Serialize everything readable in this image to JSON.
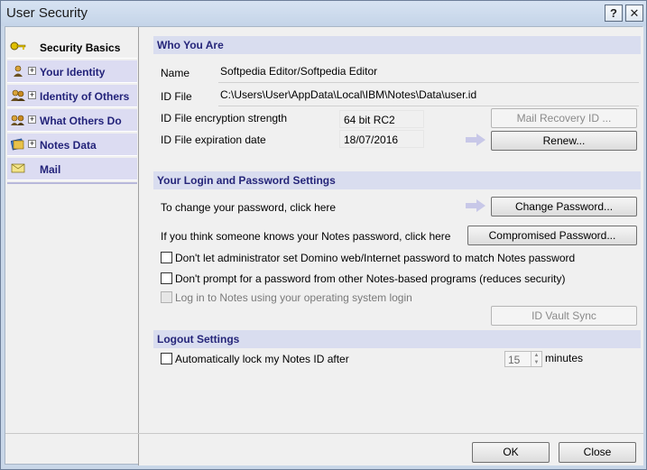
{
  "window": {
    "title": "User Security",
    "help_glyph": "?",
    "close_glyph": "✕"
  },
  "sidebar": {
    "items": [
      {
        "label": "Security Basics",
        "icon": "key-icon",
        "expandable": false,
        "active": true
      },
      {
        "label": "Your Identity",
        "icon": "person-icon",
        "expandable": true,
        "active": false
      },
      {
        "label": "Identity of Others",
        "icon": "people-icon",
        "expandable": true,
        "active": false
      },
      {
        "label": "What Others Do",
        "icon": "keys-icon",
        "expandable": true,
        "active": false
      },
      {
        "label": "Notes Data",
        "icon": "database-icon",
        "expandable": true,
        "active": false
      },
      {
        "label": "Mail",
        "icon": "mail-icon",
        "expandable": false,
        "active": false
      }
    ]
  },
  "who_you_are": {
    "heading": "Who You Are",
    "name_label": "Name",
    "name_value": "Softpedia Editor/Softpedia Editor",
    "id_file_label": "ID File",
    "id_file_value": "C:\\Users\\User\\AppData\\Local\\IBM\\Notes\\Data\\user.id",
    "encryption_label": "ID File encryption strength",
    "encryption_value": "64 bit RC2",
    "expiration_label": "ID File expiration date",
    "expiration_value": "18/07/2016",
    "mail_recovery_button": "Mail Recovery ID ...",
    "renew_button": "Renew..."
  },
  "login": {
    "heading": "Your Login and Password Settings",
    "change_text": "To change your password, click here",
    "change_button": "Change Password...",
    "compromised_text": "If you think someone knows your Notes password, click here",
    "compromised_button": "Compromised Password...",
    "opt1": "Don't let administrator set Domino web/Internet password to match Notes password",
    "opt2": "Don't prompt for a password from other Notes-based programs (reduces security)",
    "opt3": "Log in to Notes using your operating system login",
    "vault_button": "ID Vault Sync"
  },
  "logout": {
    "heading": "Logout Settings",
    "autolock_label": "Automatically lock my Notes ID after",
    "minutes_value": "15",
    "minutes_label": "minutes"
  },
  "footer": {
    "ok": "OK",
    "close": "Close"
  },
  "colors": {
    "accent": "#26267a",
    "section_bg": "#d9ddef",
    "arrow": "#c8c8e8"
  }
}
